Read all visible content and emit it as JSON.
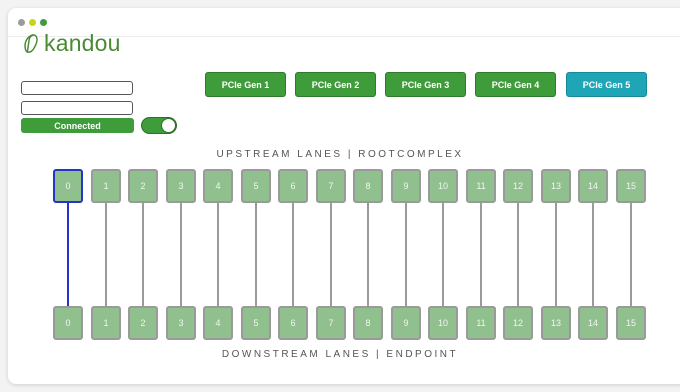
{
  "brand": {
    "name": "kandou",
    "color": "#4a8a35"
  },
  "form": {
    "field1_value": "",
    "field2_value": "",
    "status_label": "Connected",
    "toggle_on": true
  },
  "generations": [
    {
      "label": "PCIe Gen 1",
      "active": false
    },
    {
      "label": "PCIe Gen 2",
      "active": false
    },
    {
      "label": "PCIe Gen 3",
      "active": false
    },
    {
      "label": "PCIe Gen 4",
      "active": false
    },
    {
      "label": "PCIe Gen 5",
      "active": true
    }
  ],
  "upstream": {
    "heading": "UPSTREAM LANES | ROOTCOMPLEX",
    "lanes": [
      "0",
      "1",
      "2",
      "3",
      "4",
      "5",
      "6",
      "7",
      "8",
      "9",
      "10",
      "11",
      "12",
      "13",
      "14",
      "15"
    ]
  },
  "downstream": {
    "heading": "DOWNSTREAM LANES | ENDPOINT",
    "lanes": [
      "0",
      "1",
      "2",
      "3",
      "4",
      "5",
      "6",
      "7",
      "8",
      "9",
      "10",
      "11",
      "12",
      "13",
      "14",
      "15"
    ]
  },
  "selected_lane": 0,
  "colors": {
    "green": "#3f9c3a",
    "lane_fill": "#8fc08d",
    "teal_active": "#1ea5b6",
    "selected_border": "#2534c8",
    "dot_red": "#9b9b9b",
    "dot_yellow": "#c9d21c",
    "dot_green": "#3f9c3a"
  }
}
